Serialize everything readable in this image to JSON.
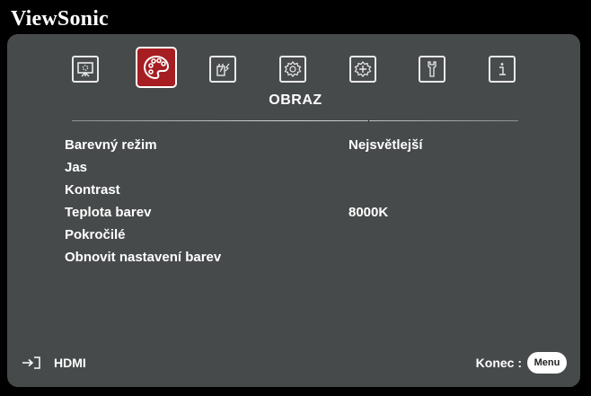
{
  "brand": "ViewSonic",
  "section_title": "OBRAZ",
  "tabs": [
    {
      "icon": "display-icon"
    },
    {
      "icon": "palette-icon",
      "active": true
    },
    {
      "icon": "power-plug-icon"
    },
    {
      "icon": "gear-icon"
    },
    {
      "icon": "advanced-gear-icon"
    },
    {
      "icon": "wrench-icon"
    },
    {
      "icon": "info-icon"
    }
  ],
  "menu": [
    {
      "label": "Barevný režim",
      "value": "Nejsvětlejší"
    },
    {
      "label": "Jas",
      "value": ""
    },
    {
      "label": "Kontrast",
      "value": ""
    },
    {
      "label": "Teplota barev",
      "value": "8000K"
    },
    {
      "label": "Pokročilé",
      "value": ""
    },
    {
      "label": "Obnovit nastavení barev",
      "value": ""
    }
  ],
  "footer": {
    "source_icon": "input-source-icon",
    "source": "HDMI",
    "exit_label": "Konec :",
    "menu_button": "Menu"
  },
  "colors": {
    "panel": "#474a4b",
    "active_tab": "#a61e22",
    "text": "#ffffff"
  }
}
